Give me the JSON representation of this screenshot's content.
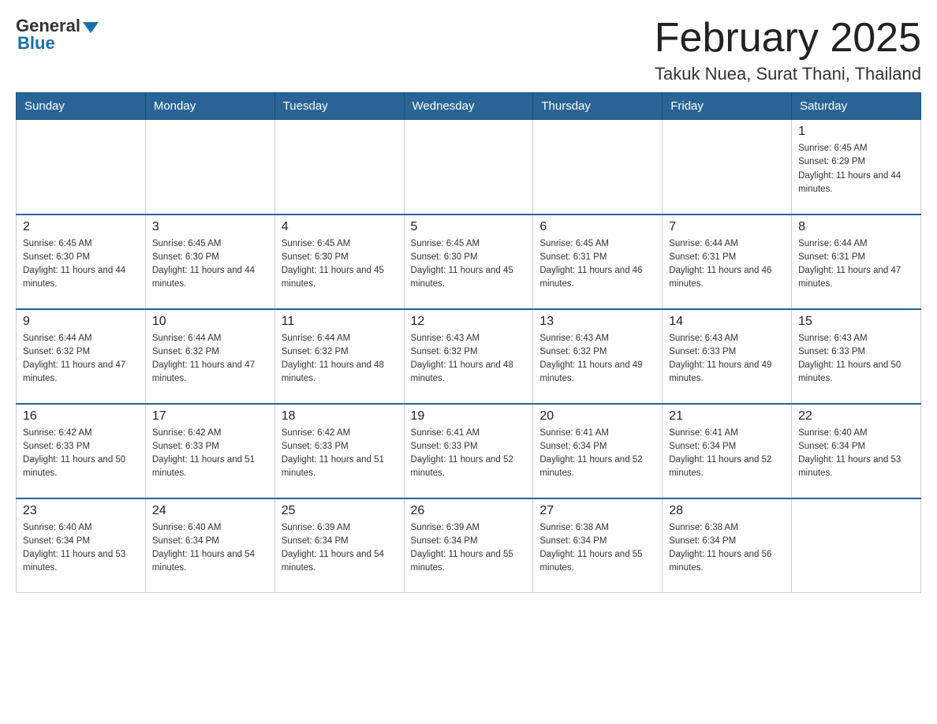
{
  "logo": {
    "text_general": "General",
    "text_blue": "Blue"
  },
  "header": {
    "month_year": "February 2025",
    "location": "Takuk Nuea, Surat Thani, Thailand"
  },
  "days_of_week": [
    "Sunday",
    "Monday",
    "Tuesday",
    "Wednesday",
    "Thursday",
    "Friday",
    "Saturday"
  ],
  "weeks": [
    [
      {
        "day": "",
        "sunrise": "",
        "sunset": "",
        "daylight": ""
      },
      {
        "day": "",
        "sunrise": "",
        "sunset": "",
        "daylight": ""
      },
      {
        "day": "",
        "sunrise": "",
        "sunset": "",
        "daylight": ""
      },
      {
        "day": "",
        "sunrise": "",
        "sunset": "",
        "daylight": ""
      },
      {
        "day": "",
        "sunrise": "",
        "sunset": "",
        "daylight": ""
      },
      {
        "day": "",
        "sunrise": "",
        "sunset": "",
        "daylight": ""
      },
      {
        "day": "1",
        "sunrise": "Sunrise: 6:45 AM",
        "sunset": "Sunset: 6:29 PM",
        "daylight": "Daylight: 11 hours and 44 minutes."
      }
    ],
    [
      {
        "day": "2",
        "sunrise": "Sunrise: 6:45 AM",
        "sunset": "Sunset: 6:30 PM",
        "daylight": "Daylight: 11 hours and 44 minutes."
      },
      {
        "day": "3",
        "sunrise": "Sunrise: 6:45 AM",
        "sunset": "Sunset: 6:30 PM",
        "daylight": "Daylight: 11 hours and 44 minutes."
      },
      {
        "day": "4",
        "sunrise": "Sunrise: 6:45 AM",
        "sunset": "Sunset: 6:30 PM",
        "daylight": "Daylight: 11 hours and 45 minutes."
      },
      {
        "day": "5",
        "sunrise": "Sunrise: 6:45 AM",
        "sunset": "Sunset: 6:30 PM",
        "daylight": "Daylight: 11 hours and 45 minutes."
      },
      {
        "day": "6",
        "sunrise": "Sunrise: 6:45 AM",
        "sunset": "Sunset: 6:31 PM",
        "daylight": "Daylight: 11 hours and 46 minutes."
      },
      {
        "day": "7",
        "sunrise": "Sunrise: 6:44 AM",
        "sunset": "Sunset: 6:31 PM",
        "daylight": "Daylight: 11 hours and 46 minutes."
      },
      {
        "day": "8",
        "sunrise": "Sunrise: 6:44 AM",
        "sunset": "Sunset: 6:31 PM",
        "daylight": "Daylight: 11 hours and 47 minutes."
      }
    ],
    [
      {
        "day": "9",
        "sunrise": "Sunrise: 6:44 AM",
        "sunset": "Sunset: 6:32 PM",
        "daylight": "Daylight: 11 hours and 47 minutes."
      },
      {
        "day": "10",
        "sunrise": "Sunrise: 6:44 AM",
        "sunset": "Sunset: 6:32 PM",
        "daylight": "Daylight: 11 hours and 47 minutes."
      },
      {
        "day": "11",
        "sunrise": "Sunrise: 6:44 AM",
        "sunset": "Sunset: 6:32 PM",
        "daylight": "Daylight: 11 hours and 48 minutes."
      },
      {
        "day": "12",
        "sunrise": "Sunrise: 6:43 AM",
        "sunset": "Sunset: 6:32 PM",
        "daylight": "Daylight: 11 hours and 48 minutes."
      },
      {
        "day": "13",
        "sunrise": "Sunrise: 6:43 AM",
        "sunset": "Sunset: 6:32 PM",
        "daylight": "Daylight: 11 hours and 49 minutes."
      },
      {
        "day": "14",
        "sunrise": "Sunrise: 6:43 AM",
        "sunset": "Sunset: 6:33 PM",
        "daylight": "Daylight: 11 hours and 49 minutes."
      },
      {
        "day": "15",
        "sunrise": "Sunrise: 6:43 AM",
        "sunset": "Sunset: 6:33 PM",
        "daylight": "Daylight: 11 hours and 50 minutes."
      }
    ],
    [
      {
        "day": "16",
        "sunrise": "Sunrise: 6:42 AM",
        "sunset": "Sunset: 6:33 PM",
        "daylight": "Daylight: 11 hours and 50 minutes."
      },
      {
        "day": "17",
        "sunrise": "Sunrise: 6:42 AM",
        "sunset": "Sunset: 6:33 PM",
        "daylight": "Daylight: 11 hours and 51 minutes."
      },
      {
        "day": "18",
        "sunrise": "Sunrise: 6:42 AM",
        "sunset": "Sunset: 6:33 PM",
        "daylight": "Daylight: 11 hours and 51 minutes."
      },
      {
        "day": "19",
        "sunrise": "Sunrise: 6:41 AM",
        "sunset": "Sunset: 6:33 PM",
        "daylight": "Daylight: 11 hours and 52 minutes."
      },
      {
        "day": "20",
        "sunrise": "Sunrise: 6:41 AM",
        "sunset": "Sunset: 6:34 PM",
        "daylight": "Daylight: 11 hours and 52 minutes."
      },
      {
        "day": "21",
        "sunrise": "Sunrise: 6:41 AM",
        "sunset": "Sunset: 6:34 PM",
        "daylight": "Daylight: 11 hours and 52 minutes."
      },
      {
        "day": "22",
        "sunrise": "Sunrise: 6:40 AM",
        "sunset": "Sunset: 6:34 PM",
        "daylight": "Daylight: 11 hours and 53 minutes."
      }
    ],
    [
      {
        "day": "23",
        "sunrise": "Sunrise: 6:40 AM",
        "sunset": "Sunset: 6:34 PM",
        "daylight": "Daylight: 11 hours and 53 minutes."
      },
      {
        "day": "24",
        "sunrise": "Sunrise: 6:40 AM",
        "sunset": "Sunset: 6:34 PM",
        "daylight": "Daylight: 11 hours and 54 minutes."
      },
      {
        "day": "25",
        "sunrise": "Sunrise: 6:39 AM",
        "sunset": "Sunset: 6:34 PM",
        "daylight": "Daylight: 11 hours and 54 minutes."
      },
      {
        "day": "26",
        "sunrise": "Sunrise: 6:39 AM",
        "sunset": "Sunset: 6:34 PM",
        "daylight": "Daylight: 11 hours and 55 minutes."
      },
      {
        "day": "27",
        "sunrise": "Sunrise: 6:38 AM",
        "sunset": "Sunset: 6:34 PM",
        "daylight": "Daylight: 11 hours and 55 minutes."
      },
      {
        "day": "28",
        "sunrise": "Sunrise: 6:38 AM",
        "sunset": "Sunset: 6:34 PM",
        "daylight": "Daylight: 11 hours and 56 minutes."
      },
      {
        "day": "",
        "sunrise": "",
        "sunset": "",
        "daylight": ""
      }
    ]
  ]
}
